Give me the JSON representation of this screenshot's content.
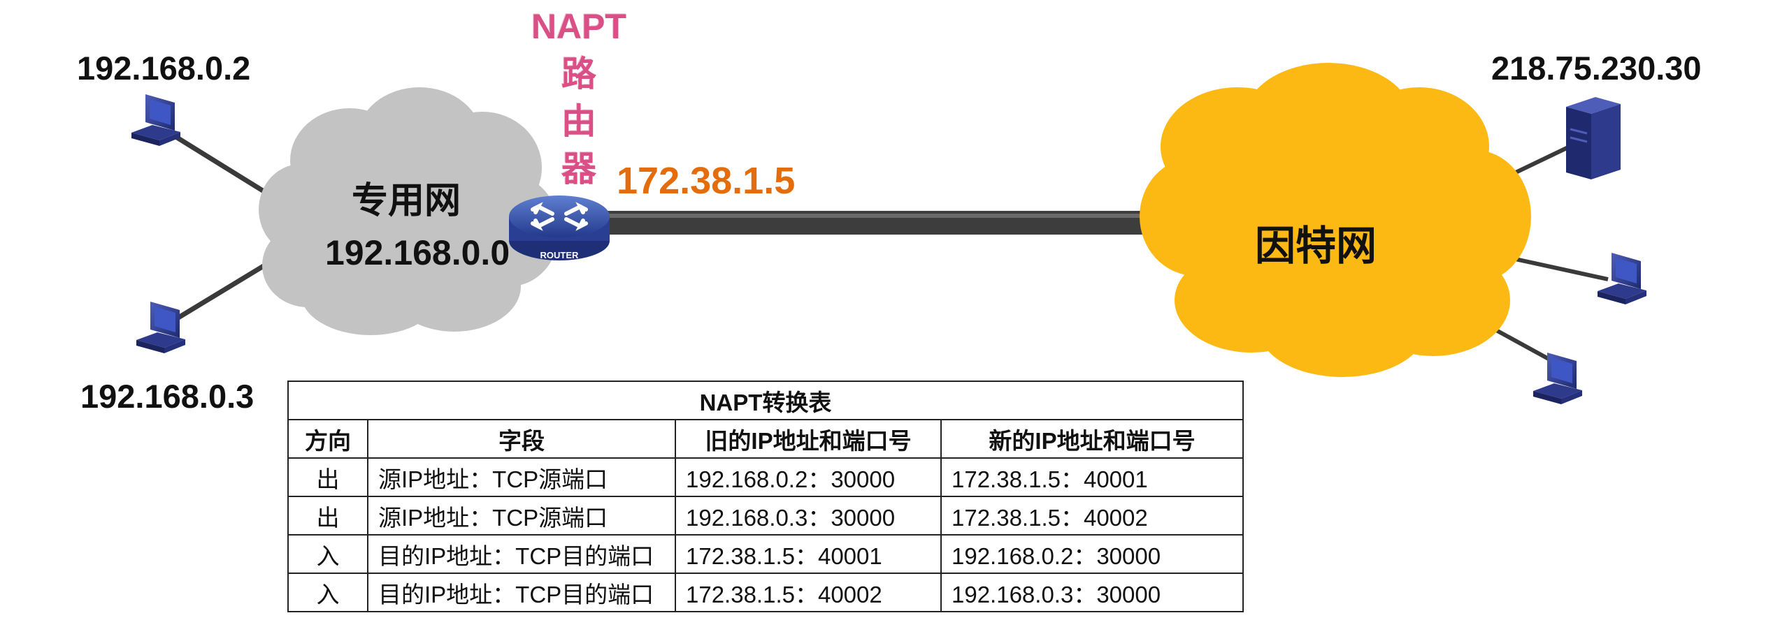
{
  "hosts": {
    "top_left_ip": "192.168.0.2",
    "bottom_left_ip": "192.168.0.3",
    "server_ip": "218.75.230.30"
  },
  "private_net": {
    "name": "专用网",
    "address": "192.168.0.0"
  },
  "router": {
    "title_lines": [
      "NAPT",
      "路",
      "由",
      "器"
    ],
    "ip": "172.38.1.5",
    "icon_text": "ROUTER"
  },
  "internet": {
    "name": "因特网"
  },
  "colors": {
    "private_cloud": "#c3c3c3",
    "internet_cloud": "#fdb913",
    "router_label": "#d94f86",
    "router_ip": "#e46c0a",
    "computer": "#2e3a8c"
  },
  "table": {
    "caption": "NAPT转换表",
    "headers": [
      "方向",
      "字段",
      "旧的IP地址和端口号",
      "新的IP地址和端口号"
    ],
    "rows": [
      [
        "出",
        "源IP地址：TCP源端口",
        "192.168.0.2：30000",
        "172.38.1.5：40001"
      ],
      [
        "出",
        "源IP地址：TCP源端口",
        "192.168.0.3：30000",
        "172.38.1.5：40002"
      ],
      [
        "入",
        "目的IP地址：TCP目的端口",
        "172.38.1.5：40001",
        "192.168.0.2：30000"
      ],
      [
        "入",
        "目的IP地址：TCP目的端口",
        "172.38.1.5：40002",
        "192.168.0.3：30000"
      ]
    ]
  }
}
